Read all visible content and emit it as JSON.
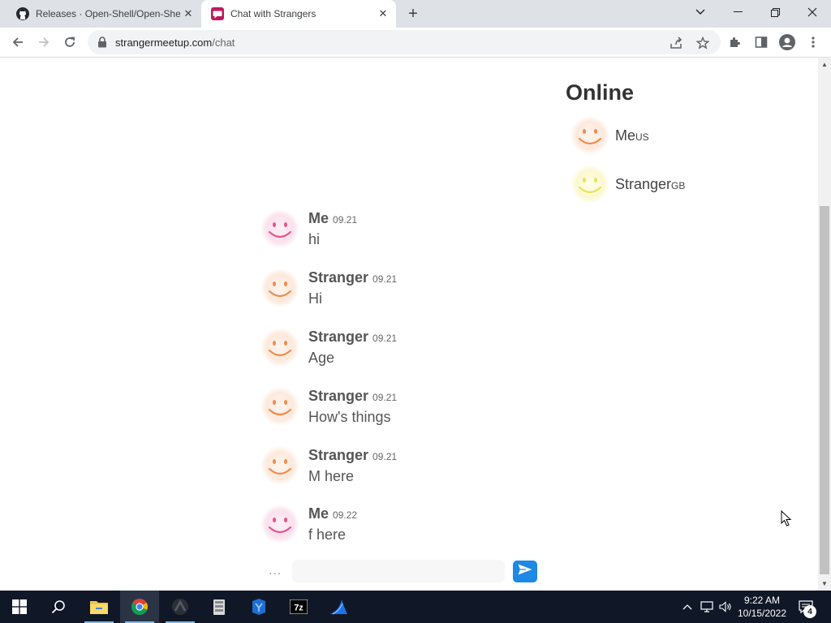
{
  "browser": {
    "tabs": [
      {
        "title": "Releases · Open-Shell/Open-Shel",
        "active": false,
        "icon": "github-icon"
      },
      {
        "title": "Chat with Strangers",
        "active": true,
        "icon": "chat-icon"
      }
    ],
    "url_domain": "strangermeetup.com",
    "url_path": "/chat"
  },
  "online": {
    "title": "Online",
    "users": [
      {
        "name": "Me",
        "country": "US",
        "color": "orange"
      },
      {
        "name": "Stranger",
        "country": "GB",
        "color": "yellow"
      }
    ]
  },
  "messages": [
    {
      "author": "Me",
      "time": "09.21",
      "text": "hi",
      "color": "pink"
    },
    {
      "author": "Stranger",
      "time": "09.21",
      "text": "Hi",
      "color": "orange"
    },
    {
      "author": "Stranger",
      "time": "09.21",
      "text": "Age",
      "color": "orange"
    },
    {
      "author": "Stranger",
      "time": "09.21",
      "text": "How's things",
      "color": "orange"
    },
    {
      "author": "Stranger",
      "time": "09.21",
      "text": "M here",
      "color": "orange"
    },
    {
      "author": "Me",
      "time": "09.22",
      "text": "f here",
      "color": "pink"
    }
  ],
  "composer": {
    "typing_indicator": "...",
    "input_value": "",
    "send_icon": "send-icon"
  },
  "colors": {
    "accent": "#1e88e5",
    "smiley_pink": "#e8508a",
    "smiley_orange": "#f08a4b",
    "smiley_yellow": "#e8e05a"
  },
  "taskbar": {
    "time": "9:22 AM",
    "date": "10/15/2022",
    "notification_count": "4",
    "pinned": [
      "start-icon",
      "search-icon",
      "file-explorer-icon",
      "chrome-icon",
      "app-icon",
      "archive-app-icon",
      "app-icon",
      "7zip-icon",
      "shark-app-icon"
    ]
  }
}
